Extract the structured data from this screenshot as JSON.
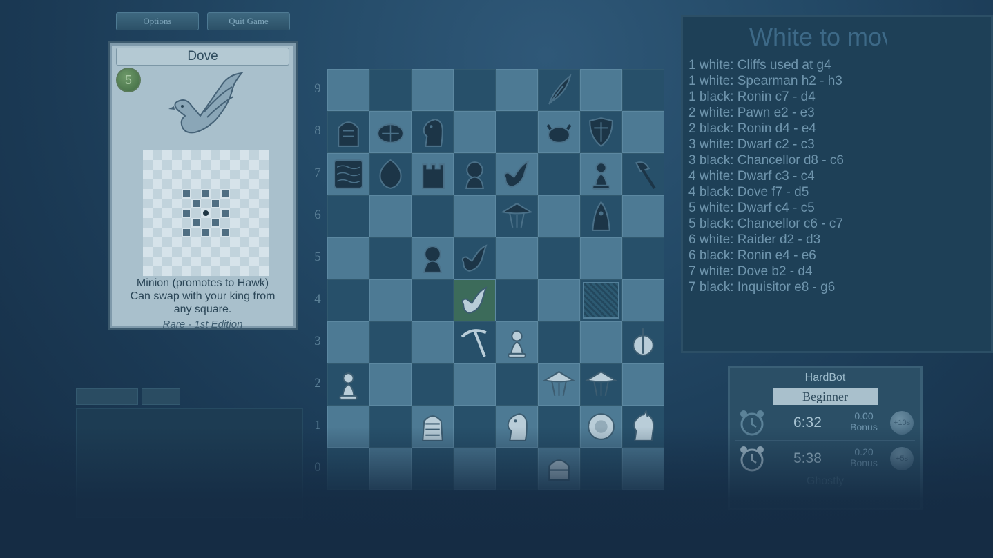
{
  "toolbar": {
    "options_label": "Options",
    "quit_label": "Quit Game"
  },
  "card": {
    "title": "Dove",
    "cost": "5",
    "description_lines": [
      "Minion (promotes to Hawk)",
      "Can swap with your king from",
      "any square."
    ],
    "rarity": "Rare - 1st Edition"
  },
  "board": {
    "rank_labels": [
      "9",
      "8",
      "7",
      "6",
      "5",
      "4",
      "3",
      "2",
      "1",
      "0"
    ],
    "files": 8,
    "pieces": [
      {
        "rank": 9,
        "file": 5,
        "icon": "feather-icon",
        "side": "black"
      },
      {
        "rank": 8,
        "file": 0,
        "icon": "tower-helmet-icon",
        "side": "black"
      },
      {
        "rank": 8,
        "file": 1,
        "icon": "turtle-icon",
        "side": "black"
      },
      {
        "rank": 8,
        "file": 2,
        "icon": "knight-icon",
        "side": "black"
      },
      {
        "rank": 8,
        "file": 5,
        "icon": "crab-icon",
        "side": "black"
      },
      {
        "rank": 8,
        "file": 6,
        "icon": "shield-icon",
        "side": "black"
      },
      {
        "rank": 7,
        "file": 0,
        "icon": "cliffs-icon",
        "side": "black"
      },
      {
        "rank": 7,
        "file": 1,
        "icon": "leaf-icon",
        "side": "black"
      },
      {
        "rank": 7,
        "file": 2,
        "icon": "castle-icon",
        "side": "black"
      },
      {
        "rank": 7,
        "file": 3,
        "icon": "ronin-icon",
        "side": "black"
      },
      {
        "rank": 7,
        "file": 4,
        "icon": "dove-icon",
        "side": "black"
      },
      {
        "rank": 7,
        "file": 6,
        "icon": "pawn-icon",
        "side": "black"
      },
      {
        "rank": 7,
        "file": 7,
        "icon": "axe-icon",
        "side": "black"
      },
      {
        "rank": 6,
        "file": 4,
        "icon": "chancellor-hat-icon",
        "side": "black"
      },
      {
        "rank": 6,
        "file": 6,
        "icon": "inquisitor-icon",
        "side": "black"
      },
      {
        "rank": 5,
        "file": 2,
        "icon": "ronin-icon",
        "side": "black"
      },
      {
        "rank": 5,
        "file": 3,
        "icon": "dove-icon",
        "side": "black"
      },
      {
        "rank": 4,
        "file": 3,
        "icon": "dove-icon",
        "side": "white"
      },
      {
        "rank": 3,
        "file": 3,
        "icon": "pickaxe-icon",
        "side": "white"
      },
      {
        "rank": 3,
        "file": 4,
        "icon": "pawn-icon",
        "side": "white"
      },
      {
        "rank": 3,
        "file": 7,
        "icon": "raider-icon",
        "side": "white"
      },
      {
        "rank": 2,
        "file": 0,
        "icon": "pawn-icon",
        "side": "white"
      },
      {
        "rank": 2,
        "file": 5,
        "icon": "chancellor-hat-icon",
        "side": "white"
      },
      {
        "rank": 2,
        "file": 6,
        "icon": "chancellor-hat-icon",
        "side": "white"
      },
      {
        "rank": 1,
        "file": 2,
        "icon": "pharaoh-icon",
        "side": "white"
      },
      {
        "rank": 1,
        "file": 4,
        "icon": "knight-icon",
        "side": "white"
      },
      {
        "rank": 1,
        "file": 6,
        "icon": "lion-icon",
        "side": "white"
      },
      {
        "rank": 1,
        "file": 7,
        "icon": "horse-icon",
        "side": "white"
      },
      {
        "rank": 0,
        "file": 5,
        "icon": "helmet-icon",
        "side": "white"
      }
    ],
    "highlight_squares": [
      {
        "rank": 4,
        "file": 3
      }
    ],
    "blocked_squares": [
      {
        "rank": 4,
        "file": 6
      }
    ]
  },
  "log": {
    "title": "White to move",
    "entries": [
      "1 white: Cliffs used at g4",
      "1 white: Spearman h2 - h3",
      "1 black: Ronin c7 - d4",
      "2 white: Pawn e2 - e3",
      "2 black: Ronin d4 - e4",
      "3 white: Dwarf c2 - c3",
      "3 black: Chancellor d8 - c6",
      "4 white: Dwarf c3 - c4",
      "4 black: Dove f7 - d5",
      "5 white: Dwarf c4 - c5",
      "5 black: Chancellor c6 - c7",
      "6 white: Raider d2 - d3",
      "6 black: Ronin e4 - e6",
      "7 white: Dove b2 - d4",
      "7 black: Inquisitor e8 - g6"
    ]
  },
  "opponent": {
    "name": "HardBot",
    "level": "Beginner",
    "clocks": [
      {
        "time": "6:32",
        "bonus_value": "0.00",
        "bonus_label": "Bonus",
        "button": "+10s",
        "icon": "alarm-clock-icon"
      },
      {
        "time": "5:38",
        "bonus_value": "0.20",
        "bonus_label": "Bonus",
        "button": "+5s",
        "icon": "alarm-clock-icon"
      }
    ],
    "player_name": "Ghostly"
  },
  "colors": {
    "light_square": "#4d7a94",
    "dark_square": "#27506a",
    "piece_white": "#b9cdd8",
    "piece_black": "#1c3547"
  }
}
